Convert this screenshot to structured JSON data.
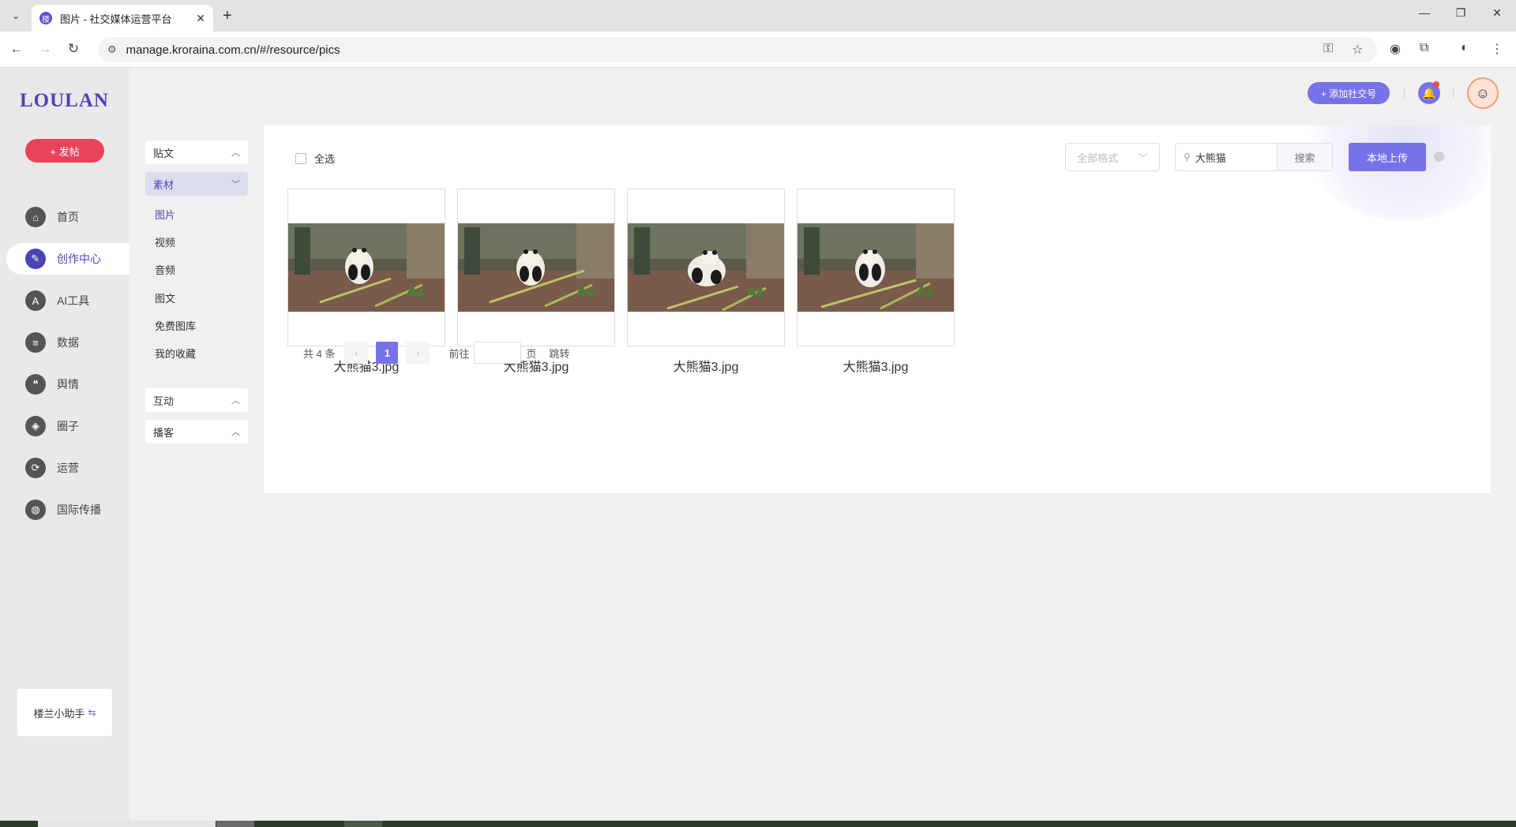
{
  "browser": {
    "tab_title": "图片 - 社交媒体运营平台",
    "tab_close": "✕",
    "new_tab": "+",
    "url": "manage.kroraina.com.cn/#/resource/pics",
    "window_controls": [
      "—",
      "❐",
      "✕"
    ]
  },
  "app": {
    "logo": "LOULAN",
    "post_button": "+ 发帖",
    "nav": [
      {
        "label": "首页",
        "icon": "home-icon",
        "glyph": "⌂"
      },
      {
        "label": "创作中心",
        "icon": "palette-icon",
        "glyph": "✎"
      },
      {
        "label": "AI工具",
        "icon": "ai-icon",
        "glyph": "A"
      },
      {
        "label": "数据",
        "icon": "database-icon",
        "glyph": "≡"
      },
      {
        "label": "舆情",
        "icon": "quote-icon",
        "glyph": "❝"
      },
      {
        "label": "圈子",
        "icon": "compass-icon",
        "glyph": "◈"
      },
      {
        "label": "运营",
        "icon": "operation-icon",
        "glyph": "⟳"
      },
      {
        "label": "国际传播",
        "icon": "globe-icon",
        "glyph": "◍"
      }
    ],
    "active_nav": "创作中心",
    "assistant": "楼兰小助手",
    "assistant_glyph": "⇆"
  },
  "submenu": {
    "groups": {
      "post": "贴文",
      "material": "素材",
      "interact": "互动",
      "broadcast": "播客"
    },
    "chev_up": "︿",
    "chev_down": "﹀",
    "material_items": [
      "图片",
      "视频",
      "音频",
      "图文",
      "免费图库",
      "我的收藏"
    ],
    "active_item": "图片"
  },
  "toolbar": {
    "select_all": "全选",
    "format_placeholder": "全部格式",
    "format_chevron": "﹀",
    "search_icon": "⚲",
    "search_value": "大熊猫",
    "search_button": "搜索",
    "upload_button": "本地上传"
  },
  "images": [
    {
      "name": "大熊猫3.jpg"
    },
    {
      "name": "大熊猫3.jpg"
    },
    {
      "name": "大熊猫3.jpg"
    },
    {
      "name": "大熊猫3.jpg"
    }
  ],
  "pagination": {
    "total": "共 4 条",
    "prev": "‹",
    "current": "1",
    "next": "›",
    "goto": "前往",
    "page_unit": "页",
    "jump": "跳转"
  },
  "header": {
    "add_social": "+ 添加社交号",
    "bell_glyph": "🔔",
    "avatar_glyph": "☺"
  },
  "colors": {
    "accent": "#7772e8",
    "brand": "#4a45b5",
    "post_button": "#e8435a"
  }
}
